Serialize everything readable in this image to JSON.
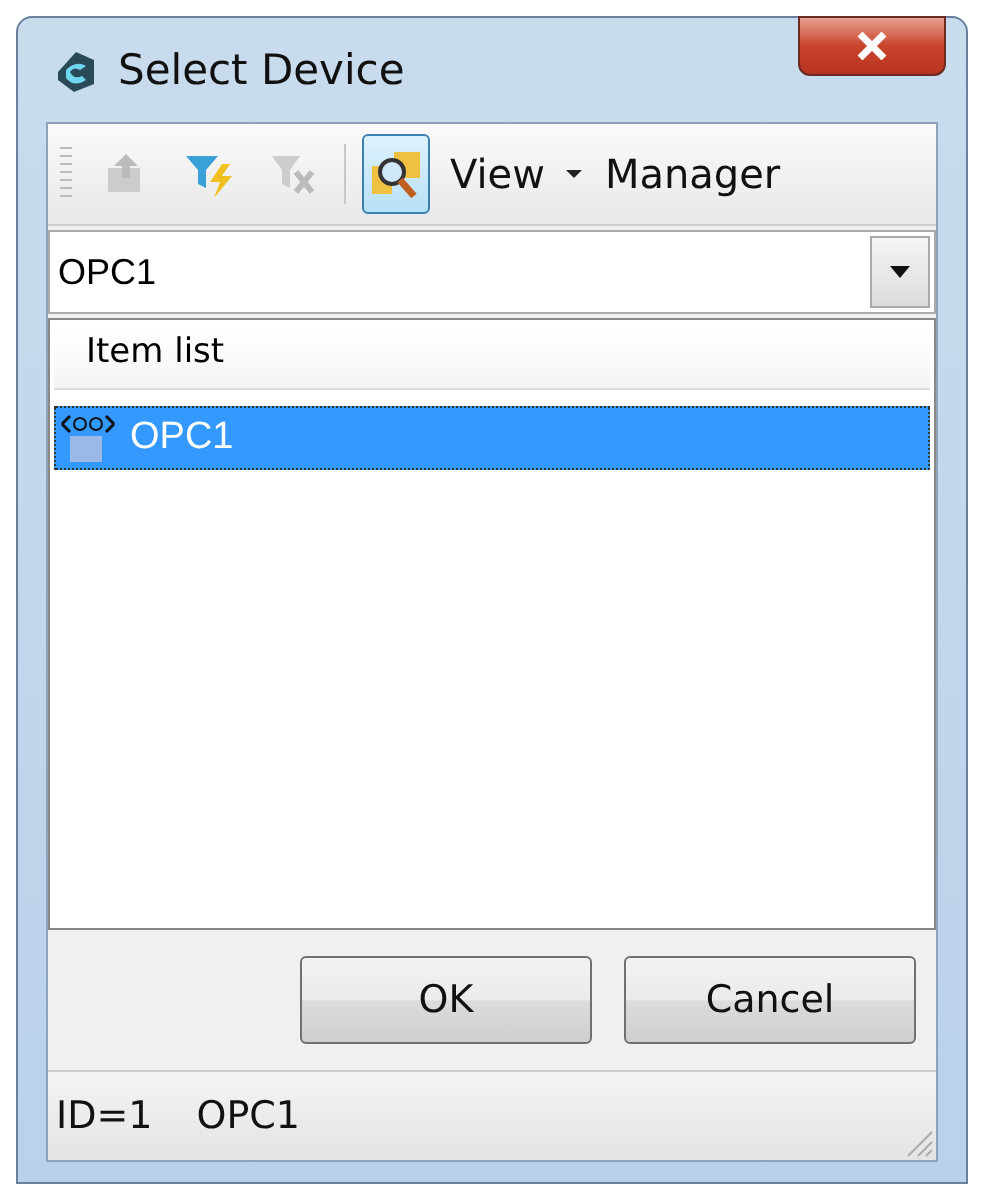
{
  "window": {
    "title": "Select Device"
  },
  "toolbar": {
    "buttons": [
      {
        "kind": "up",
        "disabled": true,
        "pressed": false
      },
      {
        "kind": "filter",
        "disabled": false,
        "pressed": false
      },
      {
        "kind": "clear",
        "disabled": true,
        "pressed": false
      },
      {
        "kind": "browse",
        "disabled": false,
        "pressed": true
      }
    ],
    "view_menu": "View",
    "manager": "Manager"
  },
  "device_combo": {
    "value": "OPC1"
  },
  "item_list": {
    "header": "Item list",
    "items": [
      {
        "label": "OPC1",
        "selected": true
      }
    ]
  },
  "buttons": [
    "OK",
    "Cancel"
  ],
  "status_bar": [
    "ID=1",
    "OPC1"
  ]
}
